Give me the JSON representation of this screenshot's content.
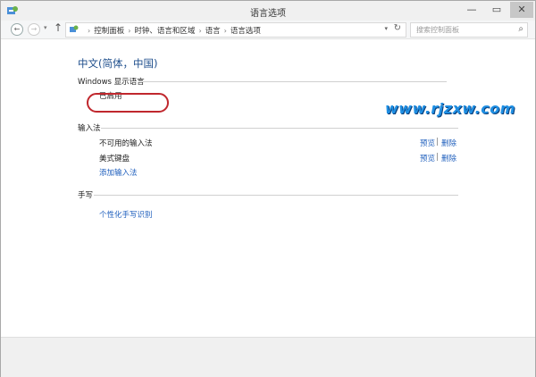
{
  "window": {
    "title": "语言选项"
  },
  "titlebar": {
    "minimize": "—",
    "maximize": "▭",
    "close": "✕"
  },
  "nav": {
    "back": "←",
    "forward": "→",
    "up": "↑",
    "breadcrumbs": [
      "控制面板",
      "时钟、语言和区域",
      "语言",
      "语言选项"
    ],
    "search_placeholder": "搜索控制面板"
  },
  "main": {
    "language_title": "中文(简体，中国)",
    "display_language": {
      "heading": "Windows 显示语言",
      "status": "已启用"
    },
    "input_methods": {
      "heading": "输入法",
      "items": [
        {
          "name": "不可用的输入法",
          "preview": "预览",
          "remove": "删除"
        },
        {
          "name": "美式键盘",
          "preview": "预览",
          "remove": "删除"
        }
      ],
      "add_link": "添加输入法"
    },
    "handwriting": {
      "heading": "手写",
      "link": "个性化手写识别"
    }
  },
  "watermark": "www.rjzxw.com"
}
